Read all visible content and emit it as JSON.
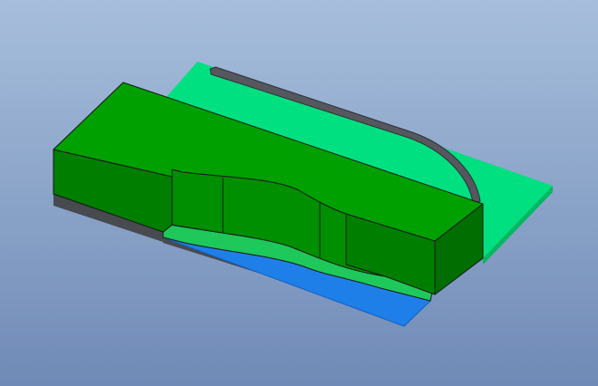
{
  "scene": {
    "background_top": "#a7bfdc",
    "background_bottom": "#6f8ab6",
    "colors": {
      "embankment_top": "#00a000",
      "embankment_side_front": "#007e00",
      "embankment_side_left": "#006e00",
      "embankment_recess_wall": "#008f00",
      "ground_plate": "#00e080",
      "ground_plate_edge": "#00b860",
      "base_slab_edge": "#474a4f",
      "water": "#1f7fe8",
      "water_edge": "#1460c0",
      "berm_strip": "#1ec85a",
      "guide_rail": "#55585e",
      "guide_rail_edge": "#2e3035",
      "outline": "#1a1a1a"
    },
    "components": [
      {
        "name": "embankment-block",
        "color_key": "embankment_top"
      },
      {
        "name": "ground-plate",
        "color_key": "ground_plate"
      },
      {
        "name": "water-channel",
        "color_key": "water"
      },
      {
        "name": "berm-strip",
        "color_key": "berm_strip"
      },
      {
        "name": "guide-rail",
        "color_key": "guide_rail"
      },
      {
        "name": "base-slab",
        "color_key": "base_slab_edge"
      }
    ]
  }
}
